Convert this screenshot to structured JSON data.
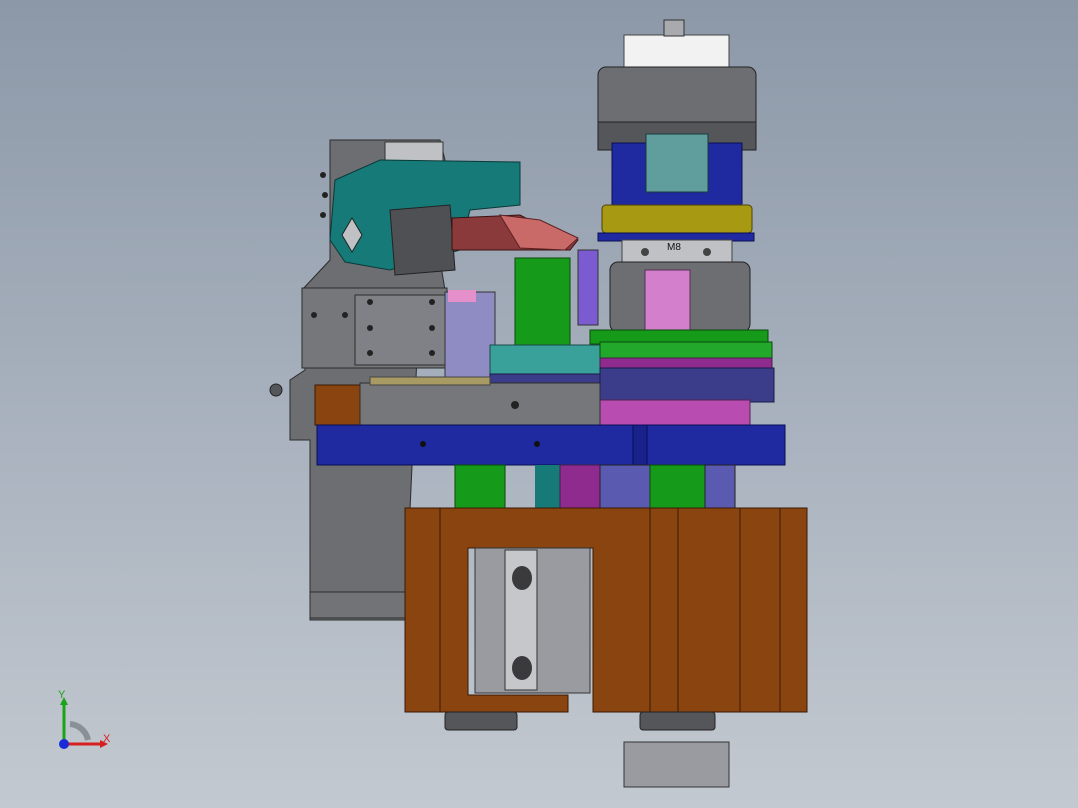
{
  "viewport": {
    "background_top": "#8c98a8",
    "background_bottom": "#c3c9d0"
  },
  "model": {
    "part_label": "M8"
  },
  "triad": {
    "x_label": "X",
    "y_label": "Y",
    "x_color": "#d62020",
    "y_color": "#19a319",
    "z_color": "#1a2ad6"
  },
  "colors": {
    "gray": "#6d6e72",
    "blue": "#1f2aa0",
    "brown": "#8a4410",
    "green": "#159a1a",
    "teal": "#157a78",
    "magenta": "#b84cb0",
    "yellow": "#a79a12",
    "salmon": "#c96a68"
  }
}
